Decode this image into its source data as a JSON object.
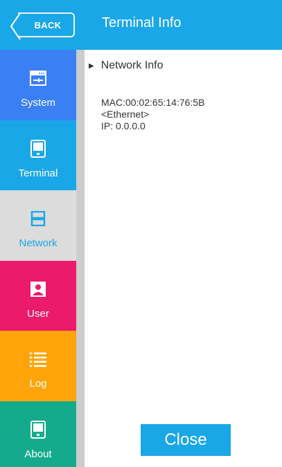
{
  "header": {
    "back_label": "BACK",
    "title": "Terminal Info"
  },
  "sidebar": {
    "items": [
      {
        "label": "System",
        "icon": "system-icon",
        "color": "#3b7ff5",
        "active": false
      },
      {
        "label": "Terminal",
        "icon": "terminal-icon",
        "color": "#1aa7e8",
        "active": false
      },
      {
        "label": "Network",
        "icon": "network-icon",
        "color": "#dcdcdc",
        "active": true
      },
      {
        "label": "User",
        "icon": "user-icon",
        "color": "#ec1a6a",
        "active": false
      },
      {
        "label": "Log",
        "icon": "log-icon",
        "color": "#ffa40a",
        "active": false
      },
      {
        "label": "About",
        "icon": "about-icon",
        "color": "#14ab8c",
        "active": false
      }
    ]
  },
  "main": {
    "section_title": "Network Info",
    "mac": "MAC:00:02:65:14:76:5B",
    "interface": "<Ethernet>",
    "ip": "IP: 0.0.0.0",
    "close_label": "Close"
  },
  "colors": {
    "accent": "#1aa7e8",
    "network_active_text": "#1aa7e8"
  }
}
